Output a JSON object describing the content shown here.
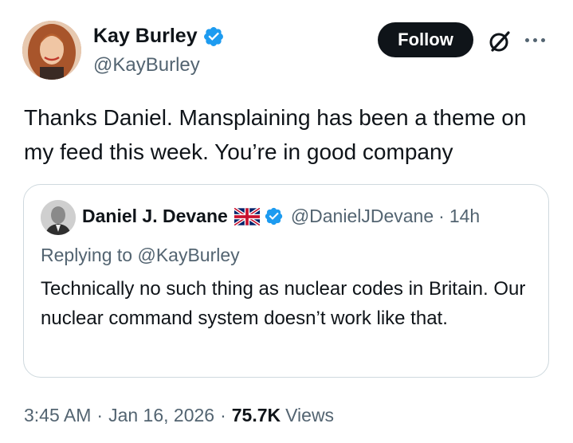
{
  "author": {
    "name": "Kay Burley",
    "handle": "@KayBurley",
    "follow_label": "Follow"
  },
  "tweet": {
    "text": "Thanks Daniel.  Mansplaining has been a theme on my feed this week.  You’re in good company"
  },
  "quoted": {
    "name": "Daniel J. Devane",
    "handle": "@DanielJDevane",
    "separator": "·",
    "time": "14h",
    "replying_prefix": "Replying to ",
    "replying_to": "@KayBurley",
    "text": "Technically no such thing as nuclear codes in Britain. Our nuclear command system doesn’t work like that."
  },
  "meta": {
    "time": "3:45 AM",
    "separator": "·",
    "date": "Jan 16, 2026",
    "views_count": "75.7K",
    "views_label": "Views"
  },
  "colors": {
    "text": "#0f1419",
    "secondary": "#536471",
    "verified": "#1d9bf0",
    "border": "#cfd9de",
    "button_bg": "#0f1419"
  },
  "icons": [
    "verified-badge-icon",
    "uk-flag-icon",
    "grok-icon",
    "more-icon"
  ]
}
